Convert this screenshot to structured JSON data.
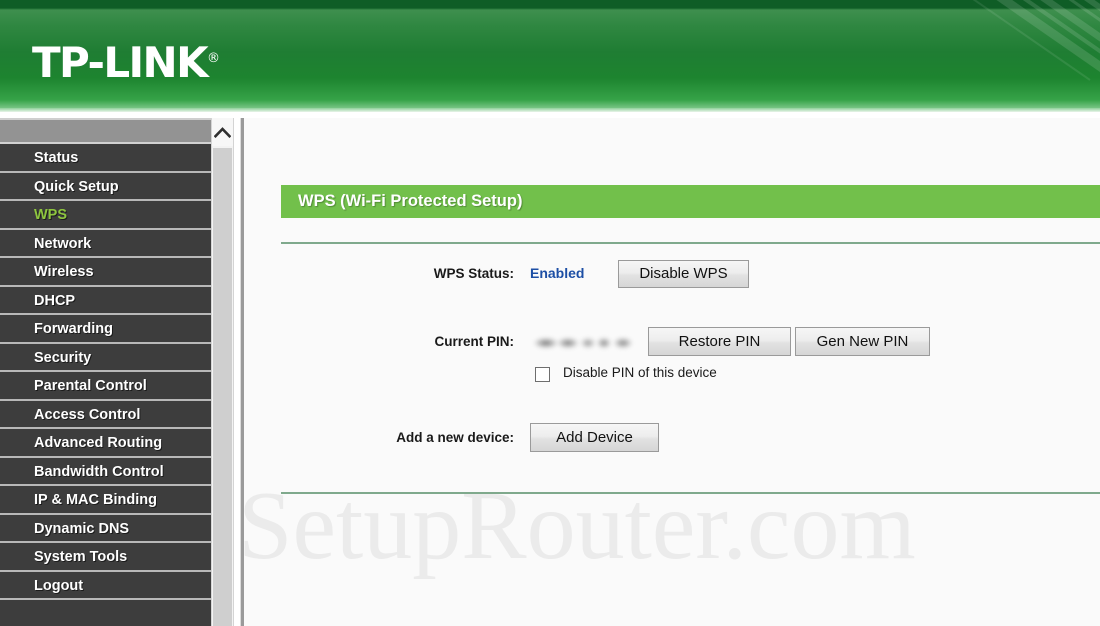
{
  "brand": {
    "name": "TP-LINK",
    "registered_mark": "®"
  },
  "sidebar": {
    "items": [
      {
        "label": "Status",
        "active": false
      },
      {
        "label": "Quick Setup",
        "active": false
      },
      {
        "label": "WPS",
        "active": true
      },
      {
        "label": "Network",
        "active": false
      },
      {
        "label": "Wireless",
        "active": false
      },
      {
        "label": "DHCP",
        "active": false
      },
      {
        "label": "Forwarding",
        "active": false
      },
      {
        "label": "Security",
        "active": false
      },
      {
        "label": "Parental Control",
        "active": false
      },
      {
        "label": "Access Control",
        "active": false
      },
      {
        "label": "Advanced Routing",
        "active": false
      },
      {
        "label": "Bandwidth Control",
        "active": false
      },
      {
        "label": "IP & MAC Binding",
        "active": false
      },
      {
        "label": "Dynamic DNS",
        "active": false
      },
      {
        "label": "System Tools",
        "active": false
      },
      {
        "label": "Logout",
        "active": false
      }
    ]
  },
  "content": {
    "panel_title": "WPS (Wi-Fi Protected Setup)",
    "watermark": "SetupRouter.com",
    "wps_status": {
      "label": "WPS Status:",
      "value": "Enabled",
      "button": "Disable WPS"
    },
    "current_pin": {
      "label": "Current PIN:",
      "value": "",
      "restore_button": "Restore PIN",
      "generate_button": "Gen New PIN",
      "checkbox_label": "Disable PIN of this device",
      "checkbox_checked": false
    },
    "add_device": {
      "label": "Add a new device:",
      "button": "Add Device"
    }
  },
  "colors": {
    "header_green": "#1f7d33",
    "panel_green": "#72c04b",
    "active_menu_green": "#8ec63f",
    "status_blue": "#1d4fa5",
    "sidebar_dark": "#3d3d3d"
  }
}
